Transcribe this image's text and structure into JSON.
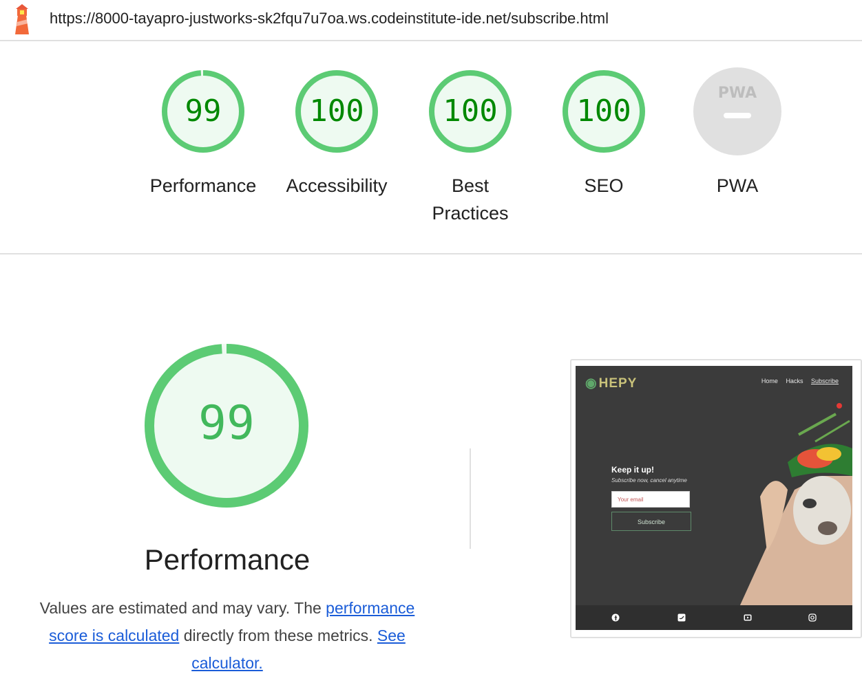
{
  "header": {
    "url": "https://8000-tayapro-justworks-sk2fqu7u7oa.ws.codeinstitute-ide.net/subscribe.html"
  },
  "scores": [
    {
      "label": "Performance",
      "value": "99",
      "fraction": 0.99
    },
    {
      "label": "Accessibility",
      "value": "100",
      "fraction": 1.0
    },
    {
      "label": "Best Practices",
      "value": "100",
      "fraction": 1.0
    },
    {
      "label": "SEO",
      "value": "100",
      "fraction": 1.0
    },
    {
      "label": "PWA",
      "value": "",
      "badge_text": "PWA"
    }
  ],
  "performance": {
    "score": "99",
    "fraction": 0.99,
    "title": "Performance",
    "note_prefix": "Values are estimated and may vary. The ",
    "link_score": "performance score is calculated",
    "note_middle": " directly from these metrics. ",
    "link_calc": "See calculator."
  },
  "screenshot": {
    "logo": "HEPY",
    "nav": [
      "Home",
      "Hacks",
      "Subscribe"
    ],
    "heading": "Keep it up!",
    "tagline": "Subscribe now, cancel anytime",
    "email_placeholder": "Your email",
    "button": "Subscribe",
    "social_icons": [
      "facebook-icon",
      "twitter-icon",
      "youtube-icon",
      "instagram-icon"
    ]
  },
  "colors": {
    "pass": "#0cce6b",
    "pass_text": "#008800",
    "gauge_fill": "#eefaf1",
    "pwa_gray": "#e0e0e0",
    "link": "#1a5cd8"
  }
}
